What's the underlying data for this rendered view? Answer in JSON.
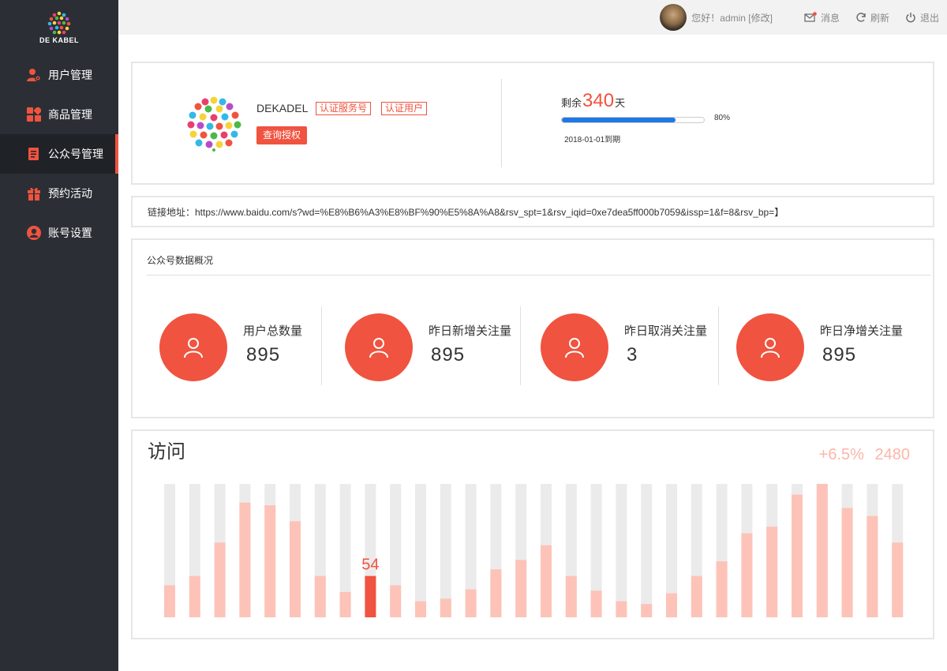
{
  "sidebar": {
    "logo_text": "DE KABEL",
    "items": [
      {
        "label": "用户管理",
        "icon": "user-gear-icon"
      },
      {
        "label": "商品管理",
        "icon": "grid-icon"
      },
      {
        "label": "公众号管理",
        "icon": "document-icon",
        "active": true
      },
      {
        "label": "预约活动",
        "icon": "gift-icon"
      },
      {
        "label": "账号设置",
        "icon": "account-circle-icon"
      }
    ]
  },
  "topbar": {
    "greeting": "您好！admin [修改]",
    "message": "消息",
    "refresh": "刷新",
    "logout": "退出"
  },
  "account": {
    "name": "DEKADEL",
    "tag_service": "认证服务号",
    "tag_user": "认证用户",
    "query_button": "查询授权",
    "remain_prefix": "剩余",
    "remain_days": "340",
    "remain_suffix": "天",
    "progress": 0.8,
    "progress_label": "80%",
    "expire_text": "2018-01-01到期"
  },
  "link": {
    "text": "链接地址：https://www.baidu.com/s?wd=%E8%B6%A3%E8%BF%90%E5%8A%A8&rsv_spt=1&rsv_iqid=0xe7dea5ff000b7059&issp=1&f=8&rsv_bp=】"
  },
  "stats": {
    "title": "公众号数据概况",
    "items": [
      {
        "label": "用户总数量",
        "value": "895"
      },
      {
        "label": "昨日新增关注量",
        "value": "895"
      },
      {
        "label": "昨日取消关注量",
        "value": "3"
      },
      {
        "label": "昨日净增关注量",
        "value": "895"
      }
    ]
  },
  "visits": {
    "title": "访问",
    "change": "+6.5%",
    "total": "2480"
  },
  "chart_data": {
    "type": "bar",
    "title": "访问",
    "values": [
      24,
      31,
      56,
      86,
      84,
      72,
      31,
      19,
      31,
      24,
      12,
      14,
      21,
      36,
      43,
      54,
      31,
      20,
      12,
      10,
      18,
      31,
      42,
      63,
      68,
      92,
      100,
      82,
      76,
      56
    ],
    "highlight_index": 8,
    "highlight_label": "54",
    "ylim": [
      0,
      100
    ],
    "colors": {
      "track": "#ebebeb",
      "bar": "#fdc3b8",
      "highlight": "#f0533f",
      "label": "#f0533f"
    }
  },
  "colors": {
    "accent": "#f0533f",
    "sidebar": "#2b2f35",
    "progress": "#1e78e6"
  }
}
